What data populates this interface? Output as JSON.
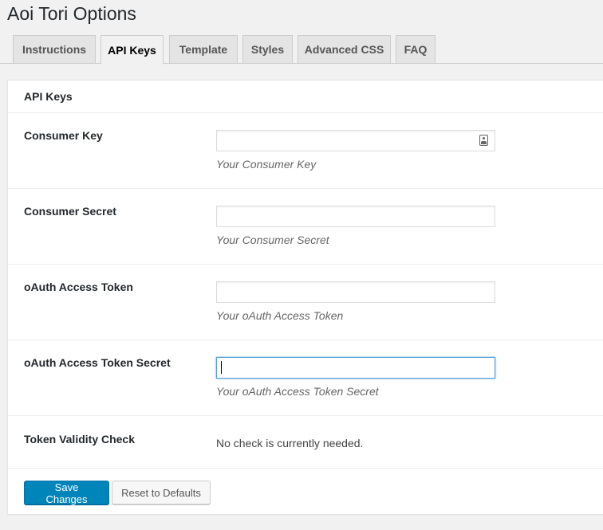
{
  "page": {
    "title": "Aoi Tori Options"
  },
  "tabs": [
    {
      "label": "Instructions",
      "active": false
    },
    {
      "label": "API Keys",
      "active": true
    },
    {
      "label": "Template",
      "active": false
    },
    {
      "label": "Styles",
      "active": false
    },
    {
      "label": "Advanced CSS",
      "active": false
    },
    {
      "label": "FAQ",
      "active": false
    }
  ],
  "section": {
    "title": "API Keys"
  },
  "fields": [
    {
      "label": "Consumer Key",
      "value": "",
      "description": "Your Consumer Key",
      "icon": "contact-card-icon"
    },
    {
      "label": "Consumer Secret",
      "value": "",
      "description": "Your Consumer Secret"
    },
    {
      "label": "oAuth Access Token",
      "value": "",
      "description": "Your oAuth Access Token"
    },
    {
      "label": "oAuth Access Token Secret",
      "value": "",
      "description": "Your oAuth Access Token Secret",
      "focused": true
    }
  ],
  "validity": {
    "label": "Token Validity Check",
    "text": "No check is currently needed."
  },
  "buttons": {
    "save": "Save Changes",
    "reset": "Reset to Defaults"
  },
  "colors": {
    "primary": "#0085ba",
    "focus_border": "#5b9dd9",
    "background": "#f1f1f1"
  }
}
